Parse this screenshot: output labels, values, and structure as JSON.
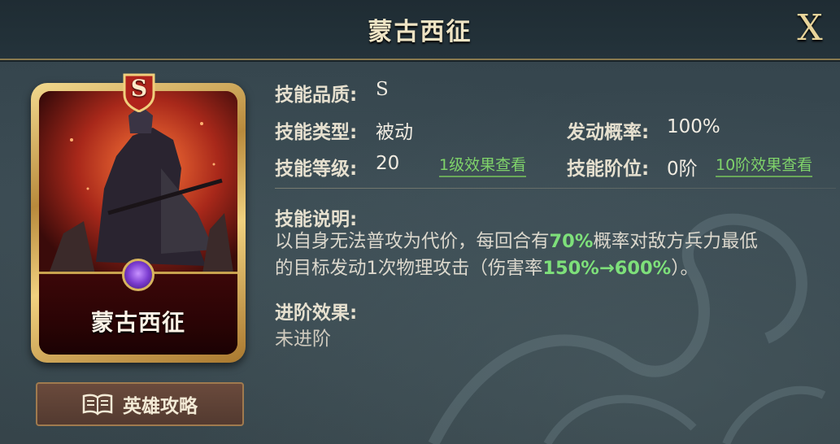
{
  "header": {
    "title": "蒙古西征",
    "close_label": "X"
  },
  "card": {
    "grade_badge": "S",
    "name": "蒙古西征"
  },
  "guide_button": {
    "label": "英雄攻略",
    "icon": "book-icon"
  },
  "skill": {
    "quality_label": "技能品质:",
    "quality_value": "S",
    "type_label": "技能类型:",
    "type_value": "被动",
    "trigger_label": "发动概率:",
    "trigger_value": "100%",
    "level_label": "技能等级:",
    "level_value": "20",
    "level1_link": "1级效果查看",
    "rank_label": "技能阶位:",
    "rank_value": "0阶",
    "rank10_link": "10阶效果查看",
    "desc_label": "技能说明:",
    "desc_line1_a": "以自身无法普攻为代价，每回合有",
    "desc_line1_hl": "70%",
    "desc_line1_b": "概率对敌方兵力最低",
    "desc_line2_a": "的目标发动1次物理攻击（伤害率",
    "desc_line2_hl": "150%→600%",
    "desc_line2_b": "）。",
    "advance_label": "进阶效果:",
    "advance_value": "未进阶"
  },
  "colors": {
    "highlight": "#7ee07a",
    "link": "#7fd36a",
    "gold": "#e8d49a"
  }
}
